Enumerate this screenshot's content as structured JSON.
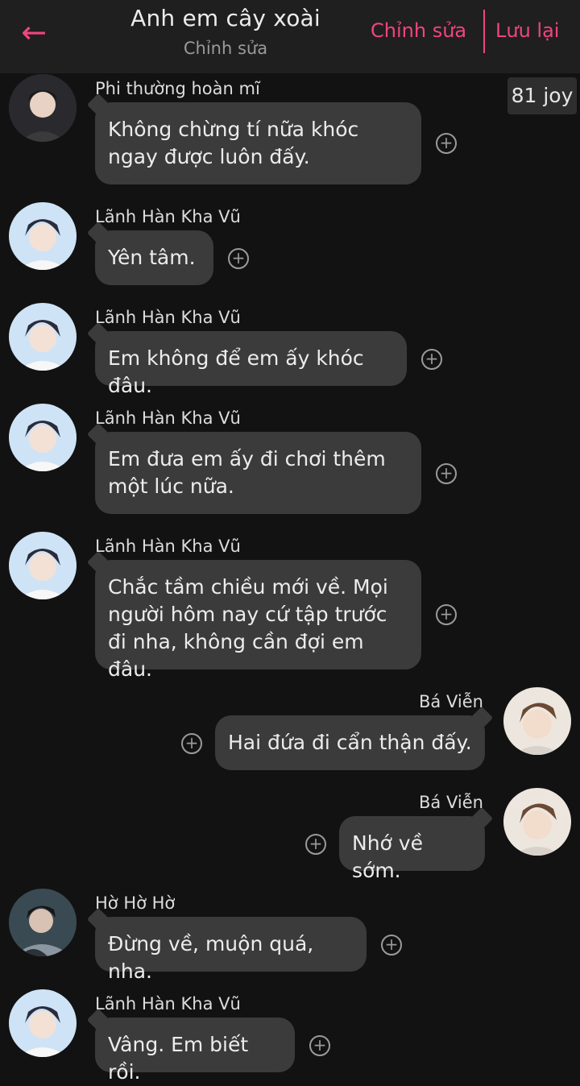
{
  "header": {
    "back_icon": "arrow-left-icon",
    "title": "Anh em cây xoài",
    "subtitle": "Chỉnh sửa",
    "edit_label": "Chỉnh sửa",
    "save_label": "Lưu lại",
    "accent_color": "#f0457f"
  },
  "badge": {
    "label": "81 joy"
  },
  "messages": [
    {
      "sender": "Phi thường hoàn mĩ",
      "text": "Không chừng tí nữa khóc ngay được luôn đấy.",
      "side": "left"
    },
    {
      "sender": "Lãnh Hàn Kha Vũ",
      "text": "Yên tâm.",
      "side": "left"
    },
    {
      "sender": "Lãnh Hàn Kha Vũ",
      "text": "Em không để em ấy khóc đâu.",
      "side": "left"
    },
    {
      "sender": "Lãnh Hàn Kha Vũ",
      "text": "Em đưa em ấy đi chơi thêm một lúc nữa.",
      "side": "left"
    },
    {
      "sender": "Lãnh Hàn Kha Vũ",
      "text": "Chắc tầm chiều mới về. Mọi người hôm nay cứ tập trước đi nha, không cần đợi em đâu.",
      "side": "left"
    },
    {
      "sender": "Bá Viễn",
      "text": "Hai đứa đi cẩn thận đấy.",
      "side": "right"
    },
    {
      "sender": "Bá Viễn",
      "text": "Nhớ về sớm.",
      "side": "right"
    },
    {
      "sender": "Hờ Hờ Hờ",
      "text": "Đừng về, muộn quá, nha.",
      "side": "left"
    },
    {
      "sender": "Lãnh Hàn Kha Vũ",
      "text": "Vâng. Em biết rồi.",
      "side": "left"
    }
  ],
  "icons": {
    "add_reaction": "plus-circle-icon",
    "avatar": "avatar-photo"
  }
}
